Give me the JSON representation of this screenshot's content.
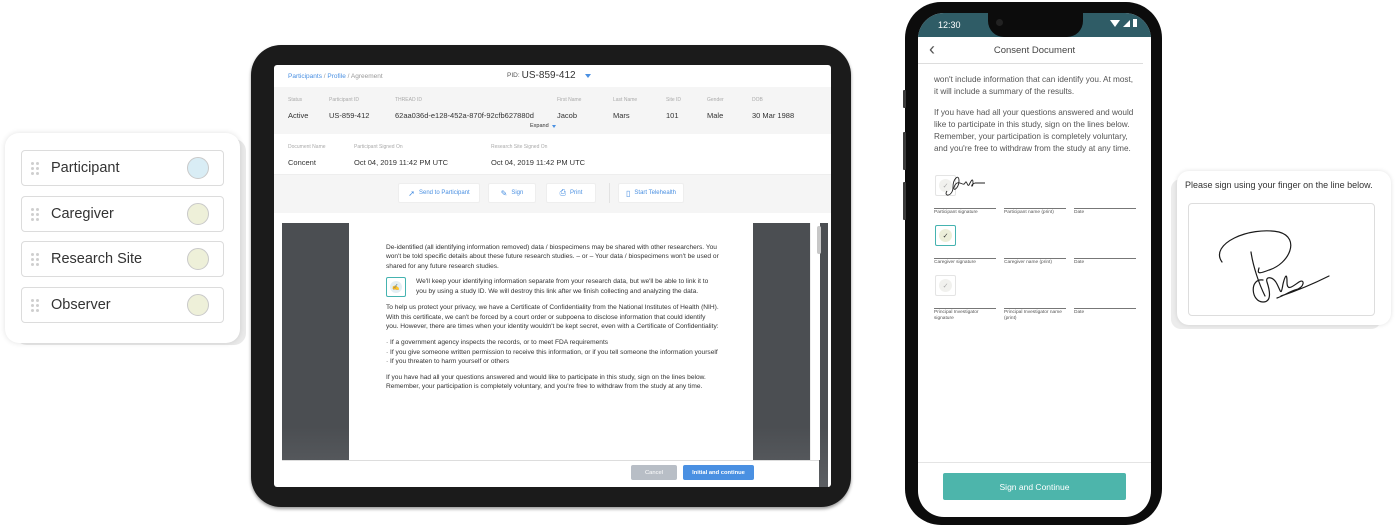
{
  "roles_panel": {
    "items": [
      {
        "label": "Participant",
        "color": "#d9edf5"
      },
      {
        "label": "Caregiver",
        "color": "#eef0d9"
      },
      {
        "label": "Research Site",
        "color": "#eef0d9"
      },
      {
        "label": "Observer",
        "color": "#eef0d9"
      }
    ]
  },
  "tablet": {
    "breadcrumb": {
      "participants": "Participants",
      "sep1": " / ",
      "profile": "Profile",
      "sep2": " / ",
      "current": "Agreement"
    },
    "pid_prefix": "PID:",
    "pid_value": "US-859-412",
    "info": [
      {
        "label": "Status",
        "value": "Active"
      },
      {
        "label": "Participant ID",
        "value": "US-859-412"
      },
      {
        "label": "THREAD ID",
        "value": "62aa036d-e128-452a-870f-92cfb627880d"
      },
      {
        "label": "First Name",
        "value": "Jacob"
      },
      {
        "label": "Last Name",
        "value": "Mars"
      },
      {
        "label": "Site ID",
        "value": "101"
      },
      {
        "label": "Gender",
        "value": "Male"
      },
      {
        "label": "DOB",
        "value": "30 Mar 1988"
      }
    ],
    "expand_label": "Expand",
    "document": [
      {
        "label": "Document Name",
        "value": "Concent"
      },
      {
        "label": "Participant Signed On",
        "value": "Oct 04, 2019 11:42 PM UTC"
      },
      {
        "label": "Research Site Signed On",
        "value": "Oct 04, 2019 11:42 PM UTC"
      }
    ],
    "actions": {
      "send": "Send to Participant",
      "sign": "Sign",
      "print": "Print",
      "telehealth": "Start Telehealth"
    },
    "page": {
      "para1": "De-identified (all identifying information removed) data / biospecimens may be shared with other researchers. You won't be told specific details about these future research studies. – or – Your data / biospecimens won't be used or shared for any future research studies.",
      "callout": "We'll keep your identifying information separate from your research data, but we'll be able to link it to you by using a study ID. We will destroy this link after we finish collecting and analyzing the data.",
      "para2": "To help us protect your privacy, we have a Certificate of Confidentiality from the National Institutes of Health (NIH). With this certificate, we can't be forced by a court order or subpoena to disclose information that could identify you. However, there are times when your identity wouldn't be kept secret, even with a Certificate of Confidentiality:",
      "bullets": [
        "· If a government agency inspects the records, or to meet FDA requirements",
        "· If you give someone written permission to receive this information, or if you tell someone the information yourself",
        "· If you threaten to harm yourself or others"
      ],
      "para3": "If you have had all your questions answered and would like to participate in this study, sign on the lines below. Remember, your participation is completely voluntary, and you're free to withdraw from the study at any time."
    },
    "footer": {
      "cancel": "Cancel",
      "initial": "Initial and continue"
    }
  },
  "phone": {
    "time": "12:30",
    "title": "Consent Document",
    "para1": "won't include information that can identify you. At most, it will include a summary of the results.",
    "para2": "If you have had all your questions answered and would like to participate in this study, sign on the lines below. Remember, your participation is completely voluntary, and you're free to withdraw from the study at any time.",
    "signature_rows": [
      [
        "Participant signature",
        "Participant name (print)",
        "Date"
      ],
      [
        "Caregiver signature",
        "Caregiver name (print)",
        "Date"
      ],
      [
        "Principal Investigator signature",
        "Principal Investigator name (print)",
        "Date"
      ]
    ],
    "sign_button": "Sign and Continue"
  },
  "sign_card": {
    "prompt": "Please sign using your finger on the line below."
  },
  "colors": {
    "accent_blue": "#4a90e2",
    "teal": "#4db5ab",
    "status_bar": "#2f5c66"
  }
}
